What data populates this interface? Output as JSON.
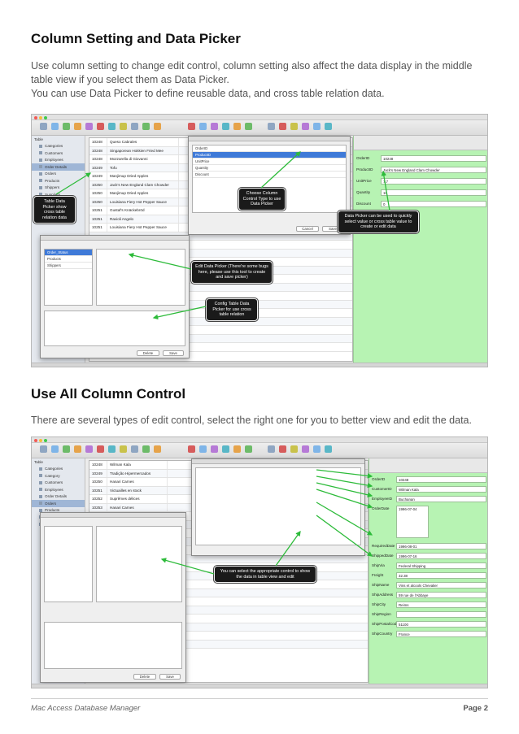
{
  "section1": {
    "title": "Column Setting and Data Picker",
    "paragraph_lines": [
      "Use column setting to change edit control, column setting also affect the data display in the middle",
      "table view if you select them as Data Picker.",
      "You can use Data Picker to define reusable data, and cross table relation data."
    ]
  },
  "section2": {
    "title": "Use All Column Control",
    "paragraph": "There are several types of edit control, select the right one for you to better view and edit the data."
  },
  "screenshot1": {
    "sidebar": [
      "Table",
      "Categories",
      "Customers",
      "Employees",
      "Order Details",
      "Orders",
      "Products",
      "Shippers",
      "Suppliers"
    ],
    "selected_sidebar_index": 4,
    "grid_rows": [
      [
        "10248",
        "Queso Cabrales"
      ],
      [
        "10248",
        "Singaporean Hokkien Fried Mee"
      ],
      [
        "10248",
        "Mozzarella di Giovanni"
      ],
      [
        "10249",
        "Tofu"
      ],
      [
        "10249",
        "Manjimup Dried Apples"
      ],
      [
        "10250",
        "Jack's New England Clam Chowder"
      ],
      [
        "10250",
        "Manjimup Dried Apples"
      ],
      [
        "10250",
        "Louisiana Fiery Hot Pepper Sauce"
      ],
      [
        "10251",
        "Gustaf's Knäckebröd"
      ],
      [
        "10251",
        "Ravioli Angelo"
      ],
      [
        "10251",
        "Louisiana Fiery Hot Pepper Sauce"
      ]
    ],
    "right_fields": [
      {
        "label": "OrderID",
        "value": "10248"
      },
      {
        "label": "ProductID",
        "value": "Jack's New England Clam Chowder"
      },
      {
        "label": "UnitPrice",
        "value": "7.7"
      },
      {
        "label": "Quantity",
        "value": "10"
      },
      {
        "label": "Discount",
        "value": "0"
      }
    ],
    "column_dialog_rows": [
      "OrderID",
      "ProductID",
      "UnitPrice",
      "Quantity",
      "Discount"
    ],
    "picker_dialog_rows": [
      "Order_Status",
      "Products",
      "Shippers"
    ],
    "buttons": {
      "add": "Add",
      "delete": "Delete",
      "save": "Save",
      "cancel": "Cancel"
    },
    "callouts": {
      "table_picker": "Table Data Picker show cross table relation data",
      "column_type": "Choose Column Control Type to use Data Picker",
      "right_picker": "Data Picker can be used to quickly select value or cross table value to create or edit data",
      "edit_picker": "Edit Data Picker (There're some bugs here, please use this tool to create and save picker)",
      "config_picker": "Config Table Data Picker for use cross table relation"
    }
  },
  "screenshot2": {
    "sidebar": [
      "Table",
      "Categories",
      "Category",
      "Customers",
      "Employees",
      "Order Details",
      "Orders",
      "Products",
      "Shippers",
      "Suppliers"
    ],
    "selected_sidebar_index": 6,
    "grid_rows": [
      [
        "10248",
        "Wilman Kala"
      ],
      [
        "10249",
        "Tradição Hipermercados"
      ],
      [
        "10250",
        "Hanari Carnes"
      ],
      [
        "10251",
        "Victuailles en stock"
      ],
      [
        "10252",
        "Suprêmes délices"
      ],
      [
        "10253",
        "Hanari Carnes"
      ],
      [
        "10254",
        "Chop-suey Chinese"
      ],
      [
        "10255",
        "Richter Supermarkt"
      ],
      [
        "10256",
        "Wellington Importadora"
      ],
      [
        "10257",
        "HILARION-Abastos"
      ],
      [
        "10258",
        "Ernst Handel"
      ],
      [
        "10259",
        "Centro comercial Moctezuma"
      ],
      [
        "10260",
        "Ottilies Käseladen"
      ],
      [
        "10261",
        "Que Delícia"
      ],
      [
        "10262",
        "Rattlesnake Canyon Grocery"
      ],
      [
        "10263",
        "Ernst Handel"
      ],
      [
        "10264",
        "Folk och fä HB"
      ],
      [
        "10265",
        "Blondel père et fils"
      ],
      [
        "10266",
        "Wartian Herkku"
      ],
      [
        "10267",
        "Frankenversand"
      ],
      [
        "10268",
        "GROSELLA-Restaurante"
      ],
      [
        "10269",
        "White Clover Markets"
      ]
    ],
    "right_fields": [
      {
        "label": "OrderID",
        "value": "10248"
      },
      {
        "label": "CustomerID",
        "value": "Wilman Kala"
      },
      {
        "label": "EmployeeID",
        "value": "Buchanan"
      },
      {
        "label": "OrderDate",
        "value": "1996-07-04"
      },
      {
        "label": "RequiredDate",
        "value": "1996-08-01"
      },
      {
        "label": "ShippedDate",
        "value": "1996-07-16"
      },
      {
        "label": "ShipVia",
        "value": "Federal Shipping"
      },
      {
        "label": "Freight",
        "value": "32.38"
      },
      {
        "label": "ShipName",
        "value": "Vins et alcools Chevalier"
      },
      {
        "label": "ShipAddress",
        "value": "59 rue de l'Abbaye"
      },
      {
        "label": "ShipCity",
        "value": "Reims"
      },
      {
        "label": "ShipRegion",
        "value": ""
      },
      {
        "label": "ShipPostalCode",
        "value": "51100"
      },
      {
        "label": "ShipCountry",
        "value": "France"
      }
    ],
    "callout": "You can select the appropriate control to show the data in table view and edit"
  },
  "footer": {
    "left": "Mac Access Database Manager",
    "right": "Page 2"
  },
  "colors": {
    "right_panel": "#b7f3b3",
    "arrow": "#2dbb3a",
    "callout_bg": "#1a1a1a"
  }
}
